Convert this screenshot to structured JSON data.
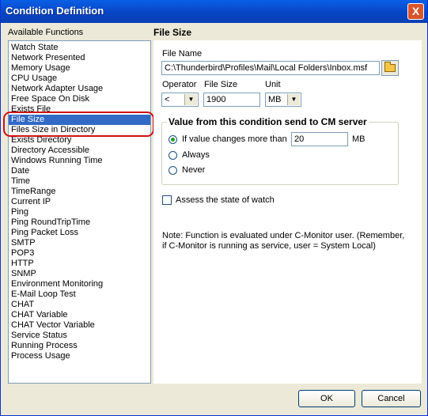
{
  "window": {
    "title": "Condition Definition",
    "close_label": "X"
  },
  "left": {
    "label": "Available Functions",
    "items": [
      "Watch State",
      "Network Presented",
      "Memory Usage",
      "CPU Usage",
      "Network Adapter Usage",
      "Free Space On Disk",
      "Exists File",
      "File Size",
      "Files Size in Directory",
      "Exists Directory",
      "Directory Accessible",
      "Windows Running Time",
      "Date",
      "Time",
      "TimeRange",
      "Current IP",
      "Ping",
      "Ping RoundTripTime",
      "Ping Packet Loss",
      "SMTP",
      "POP3",
      "HTTP",
      "SNMP",
      "Environment Monitoring",
      "E-Mail Loop Test",
      "CHAT",
      "CHAT Variable",
      "CHAT Vector Variable",
      "Service Status",
      "Running Process",
      "Process Usage"
    ],
    "selected": "File Size"
  },
  "right": {
    "title": "File Size",
    "file_name_label": "File Name",
    "file_name_value": "C:\\Thunderbird\\Profiles\\Mail\\Local Folders\\Inbox.msf",
    "operator_label": "Operator",
    "operator_value": "<",
    "file_size_label": "File Size",
    "file_size_value": "1900",
    "unit_label": "Unit",
    "unit_value": "MB",
    "group_title": "Value from this condition send to CM server",
    "radio_change_label": "If value changes more than",
    "radio_change_value": "20",
    "radio_change_unit": "MB",
    "radio_always_label": "Always",
    "radio_never_label": "Never",
    "assess_label": "Assess the state of watch",
    "note": "Note: Function is evaluated under C-Monitor user. (Remember, if C-Monitor is running as service, user = System Local)"
  },
  "buttons": {
    "ok": "OK",
    "cancel": "Cancel"
  }
}
